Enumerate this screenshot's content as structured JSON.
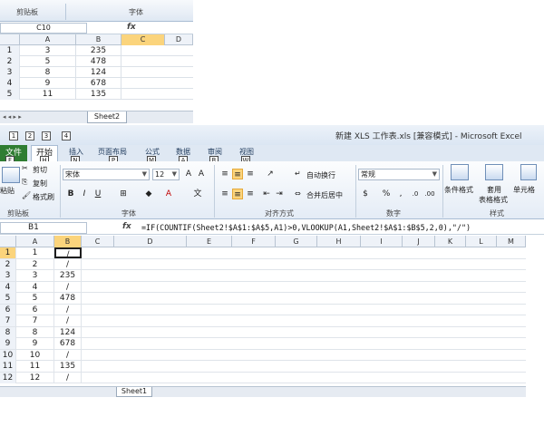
{
  "top_window": {
    "groups": [
      "剪贴板",
      "字体"
    ],
    "name_box": "C10",
    "fx": "fx",
    "columns": [
      "A",
      "B",
      "C",
      "D"
    ],
    "rows": [
      {
        "num": "1",
        "a": "3",
        "b": "235"
      },
      {
        "num": "2",
        "a": "5",
        "b": "478"
      },
      {
        "num": "3",
        "a": "8",
        "b": "124"
      },
      {
        "num": "4",
        "a": "9",
        "b": "678"
      },
      {
        "num": "5",
        "a": "11",
        "b": "135"
      }
    ],
    "sheet_tab": "Sheet2"
  },
  "main_window": {
    "title": "新建 XLS 工作表.xls [兼容模式] - Microsoft Excel",
    "qat_keys": [
      "1",
      "2",
      "3",
      "4"
    ],
    "tabs": [
      {
        "label": "文件",
        "key": "F"
      },
      {
        "label": "开始",
        "key": "H"
      },
      {
        "label": "插入",
        "key": "N"
      },
      {
        "label": "页面布局",
        "key": "P"
      },
      {
        "label": "公式",
        "key": "M"
      },
      {
        "label": "数据",
        "key": "A"
      },
      {
        "label": "审阅",
        "key": "R"
      },
      {
        "label": "视图",
        "key": "W"
      }
    ],
    "ribbon": {
      "paste": "粘贴",
      "cut": "剪切",
      "copy": "复制",
      "format_painter": "格式刷",
      "font_name": "宋体",
      "font_size": "12",
      "wrap_text": "自动换行",
      "merge_center": "合并后居中",
      "number_format": "常规",
      "conditional_format": "条件格式",
      "format_table_top": "套用",
      "format_table_bottom": "表格格式",
      "cell_styles": "单元格",
      "group_clipboard": "剪贴板",
      "group_font": "字体",
      "group_alignment": "对齐方式",
      "group_number": "数字",
      "group_styles": "样式"
    },
    "name_box": "B1",
    "fx": "fx",
    "formula": "=IF(COUNTIF(Sheet2!$A$1:$A$5,A1)>0,VLOOKUP(A1,Sheet2!$A$1:$B$5,2,0),\"/\")",
    "columns": [
      "A",
      "B",
      "C",
      "D",
      "E",
      "F",
      "G",
      "H",
      "I",
      "J",
      "K",
      "L",
      "M"
    ],
    "rows": [
      {
        "num": "1",
        "a": "1",
        "b": "/"
      },
      {
        "num": "2",
        "a": "2",
        "b": "/"
      },
      {
        "num": "3",
        "a": "3",
        "b": "235"
      },
      {
        "num": "4",
        "a": "4",
        "b": "/"
      },
      {
        "num": "5",
        "a": "5",
        "b": "478"
      },
      {
        "num": "6",
        "a": "6",
        "b": "/"
      },
      {
        "num": "7",
        "a": "7",
        "b": "/"
      },
      {
        "num": "8",
        "a": "8",
        "b": "124"
      },
      {
        "num": "9",
        "a": "9",
        "b": "678"
      },
      {
        "num": "10",
        "a": "10",
        "b": "/"
      },
      {
        "num": "11",
        "a": "11",
        "b": "135"
      },
      {
        "num": "12",
        "a": "12",
        "b": "/"
      }
    ],
    "sheet_tab": "Sheet1"
  }
}
